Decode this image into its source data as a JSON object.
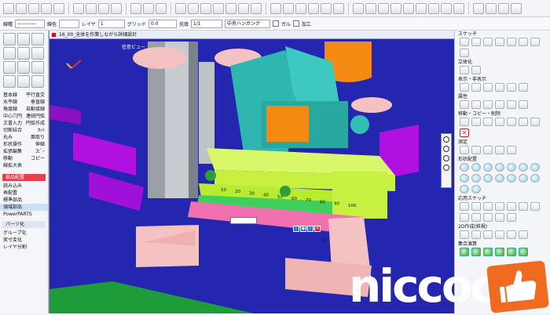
{
  "toolbar2": {
    "line_label": "線種",
    "color_label": "線色",
    "layer_label": "レイヤ",
    "layer_value": "1",
    "grid_label": "グリッド",
    "grid_value": "0.0",
    "fill_label": "充填",
    "fill_value": "1/1",
    "hatch_value": "中央ハンガング",
    "option1": "ガル",
    "option2": "加工"
  },
  "left_menu": {
    "rows": [
      [
        "基本線",
        "平行直交"
      ],
      [
        "水平線",
        "垂直線"
      ],
      [
        "角度線",
        "自動接線"
      ],
      [
        "中心穴円",
        "連続円弧"
      ],
      [
        "文書入力",
        "円弧作成"
      ],
      [
        "切断結合",
        "ｶｯﾄ"
      ],
      [
        "丸み",
        "面取り"
      ],
      [
        "形状操作",
        "伸縮"
      ],
      [
        "拡張編集",
        "ｺﾋﾟｰ"
      ],
      [
        "移動",
        "コピー"
      ],
      [
        "線拡大表",
        ""
      ]
    ],
    "parts_tab": "部品配置",
    "parts_items": [
      "読み込み",
      "再配置",
      "標準部品",
      "領域部品",
      "PowerPARTS"
    ],
    "parts_selected_index": 3,
    "parts2_tab": "パーツ化",
    "parts2_items": [
      "グループ化",
      "実寸変化",
      "レイヤ分割"
    ]
  },
  "viewport": {
    "title": "16_00_全体を作業しながら詳細設計",
    "view_name": "任意ビュー",
    "ruler_labels": [
      "10",
      "20",
      "30",
      "40",
      "50",
      "60",
      "70",
      "80",
      "90",
      "100"
    ],
    "dim_label": "33",
    "colors": {
      "background": "#2426b0",
      "frame": "#a6a6a6",
      "magenta": "#b010e0",
      "salmon": "#f4c2c2",
      "teal": "#2fb6b0",
      "orange": "#f58a12",
      "lime": "#c8f040",
      "green": "#3ed05a"
    }
  },
  "right_panel": {
    "sections": [
      {
        "title": "スケッチ",
        "icons": 8
      },
      {
        "title": "立体化",
        "icons": 2
      },
      {
        "title": "表示・非表示",
        "icons": 6
      },
      {
        "title": "属性",
        "icons": 6
      },
      {
        "title": "移動・コピー・削除",
        "icons": 7
      },
      {
        "title": "",
        "icons": 1,
        "danger": true
      },
      {
        "title": "測定",
        "icons": 5
      },
      {
        "title": "形状配置",
        "icons": 16,
        "teal": true
      },
      {
        "title": "応用スケッチ",
        "icons": 12
      },
      {
        "title": "2D作成(斜視)",
        "icons": 6
      },
      {
        "title": "集合演算",
        "icons": 6,
        "green": true
      }
    ]
  },
  "branding": {
    "logo_text": "niccoc",
    "logo_color": "#f06a1f"
  }
}
